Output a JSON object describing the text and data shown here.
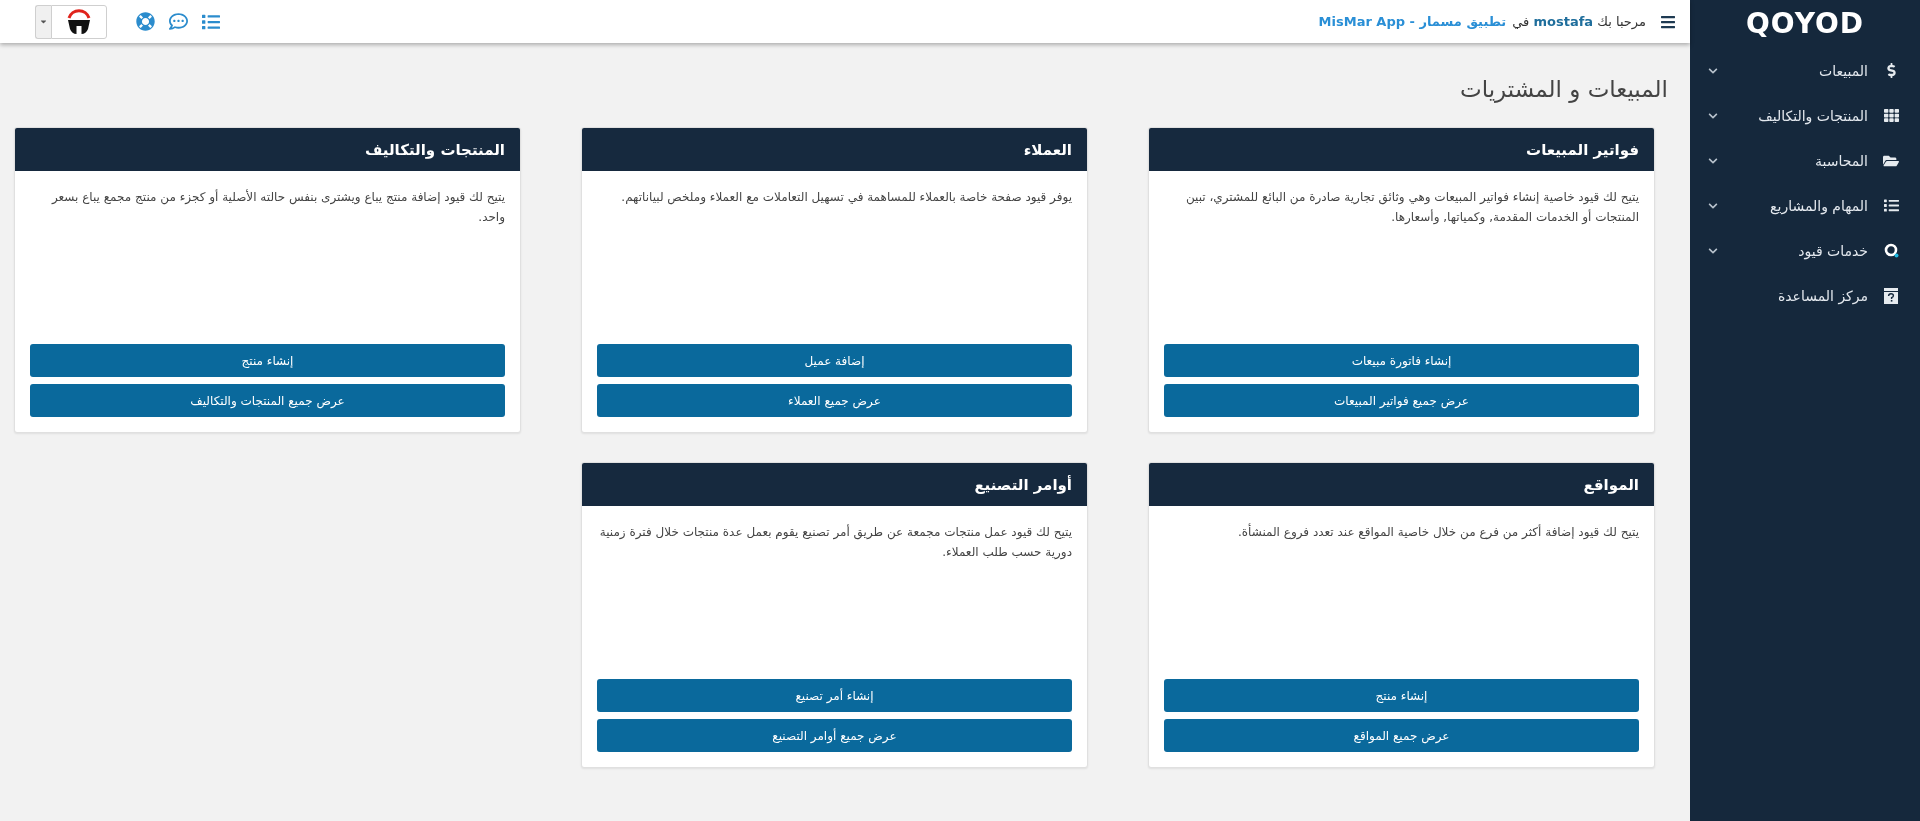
{
  "topbar": {
    "greeting": "مرحبا بك **mostafa** في",
    "app_link": "تطبيق مسمار - MisMar App"
  },
  "sidebar": {
    "logo": "QOYOD",
    "items": [
      {
        "label": "المبيعات",
        "kind": "submenu"
      },
      {
        "label": "المنتجات والتكاليف",
        "kind": "submenu"
      },
      {
        "label": "المحاسبة",
        "kind": "submenu"
      },
      {
        "label": "المهام والمشاريع",
        "kind": "submenu"
      },
      {
        "label": "خدمات قيود",
        "kind": "submenu"
      },
      {
        "label": "مركز المساعدة",
        "kind": "link"
      }
    ]
  },
  "page_title": "المبيعات و المشتريات",
  "cards": [
    {
      "title": "فواتير المبيعات",
      "description": "يتيح لك قيود خاصية إنشاء فواتير المبيعات وهي وثائق تجارية صادرة من البائع للمشتري، تبين المنتجات أو الخدمات المقدمة, وكمياتها, وأسعارها.",
      "buttons": [
        "إنشاء فاتورة مبيعات",
        "عرض جميع فواتير المبيعات"
      ]
    },
    {
      "title": "العملاء",
      "description": "يوفر قيود صفحة خاصة بالعملاء للمساهمة في تسهيل التعاملات مع العملاء وملخص لبياناتهم.",
      "buttons": [
        "إضافة عميل",
        "عرض جميع العملاء"
      ]
    },
    {
      "title": "المنتجات والتكاليف",
      "description": "يتيح لك قيود إضافة منتج يباع ويشترى بنفس حالته الأصلية أو كجزء من منتج مجمع يباع بسعر واحد.",
      "buttons": [
        "إنشاء منتج",
        "عرض جميع المنتجات والتكاليف"
      ]
    },
    {
      "title": "المواقع",
      "description": "يتيح لك قيود إضافة أكثر من فرع من خلال خاصية المواقع عند تعدد فروع المنشأة.",
      "buttons": [
        "إنشاء منتج",
        "عرض جميع المواقع"
      ]
    },
    {
      "title": "أوامر التصنيع",
      "description": "يتيح لك قيود عمل منتجات مجمعة عن طريق أمر تصنيع يقوم بعمل عدة منتجات خلال فترة زمنية دورية حسب طلب العملاء.",
      "buttons": [
        "إنشاء أمر تصنيع",
        "عرض جميع أوامر التصنيع"
      ]
    }
  ]
}
